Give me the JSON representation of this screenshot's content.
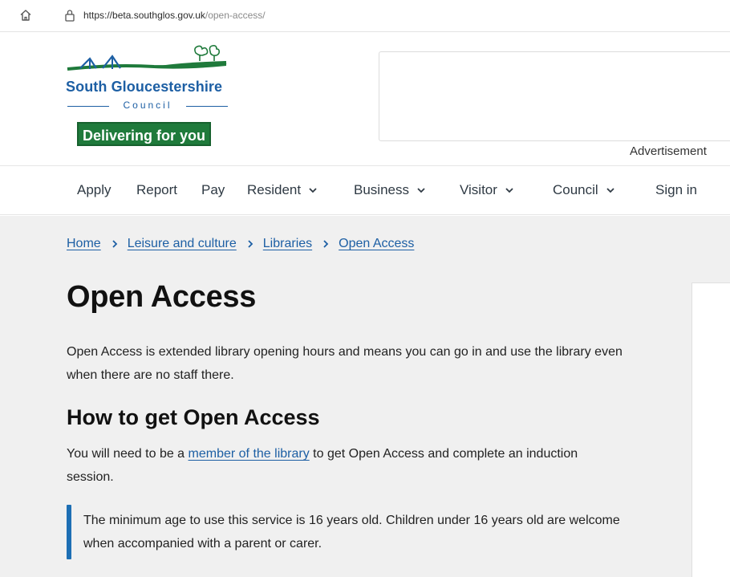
{
  "browser": {
    "url_host": "https://beta.southglos.gov.uk",
    "url_path": "/open-access/"
  },
  "logo": {
    "name": "South Gloucestershire",
    "council": "Council",
    "tagline_part1": "Delivering",
    "tagline_part2": "for you",
    "colors": {
      "blue": "#1d5fa4",
      "green": "#1f7a3b"
    }
  },
  "advertisement": {
    "label": "Advertisement"
  },
  "nav": {
    "items": [
      {
        "label": "Apply",
        "dropdown": false
      },
      {
        "label": "Report",
        "dropdown": false
      },
      {
        "label": "Pay",
        "dropdown": false
      },
      {
        "label": "Resident",
        "dropdown": true
      },
      {
        "label": "Business",
        "dropdown": true
      },
      {
        "label": "Visitor",
        "dropdown": true
      },
      {
        "label": "Council",
        "dropdown": true
      },
      {
        "label": "Sign in",
        "dropdown": false
      }
    ]
  },
  "breadcrumb": {
    "items": [
      "Home",
      "Leisure and culture",
      "Libraries",
      "Open Access"
    ]
  },
  "page": {
    "title": "Open Access",
    "intro": "Open Access is extended library opening hours and means you can go in and use the library even when there are no staff there.",
    "section_heading": "How to get Open Access",
    "para_before_link": "You will need to be a ",
    "para_link": "member of the library",
    "para_after_link": " to get Open Access and complete an induction session.",
    "callout": "The minimum age to use this service is 16 years old. Children under 16 years old are welcome when accompanied with a parent or carer."
  }
}
